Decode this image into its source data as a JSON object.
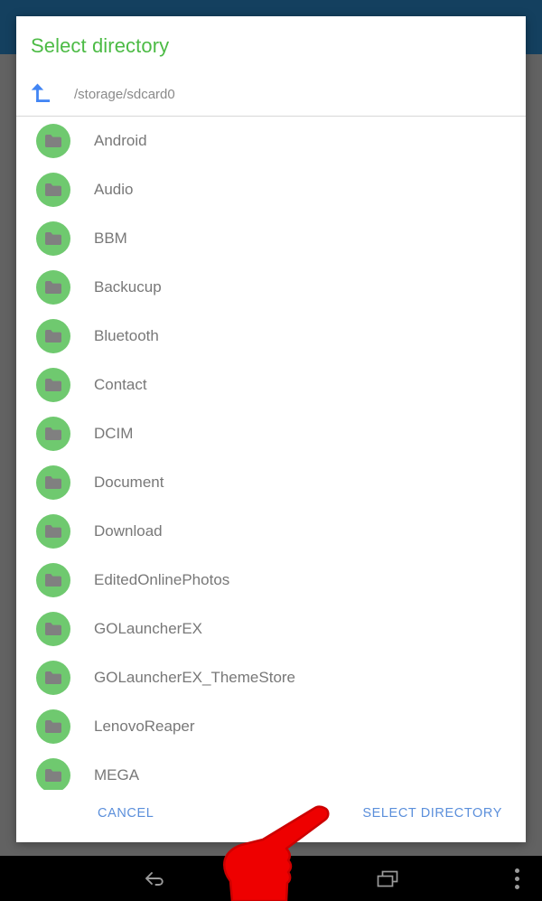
{
  "dialog": {
    "title": "Select directory",
    "path": {
      "icon": "arrow-up-icon",
      "value": "/storage/sdcard0"
    },
    "items": [
      {
        "icon": "folder-icon",
        "label": "Android"
      },
      {
        "icon": "folder-icon",
        "label": "Audio"
      },
      {
        "icon": "folder-icon",
        "label": "BBM"
      },
      {
        "icon": "folder-icon",
        "label": "Backucup"
      },
      {
        "icon": "folder-icon",
        "label": "Bluetooth"
      },
      {
        "icon": "folder-icon",
        "label": "Contact"
      },
      {
        "icon": "folder-icon",
        "label": "DCIM"
      },
      {
        "icon": "folder-icon",
        "label": "Document"
      },
      {
        "icon": "folder-icon",
        "label": "Download"
      },
      {
        "icon": "folder-icon",
        "label": "EditedOnlinePhotos"
      },
      {
        "icon": "folder-icon",
        "label": "GOLauncherEX"
      },
      {
        "icon": "folder-icon",
        "label": "GOLauncherEX_ThemeStore"
      },
      {
        "icon": "folder-icon",
        "label": "LenovoReaper"
      },
      {
        "icon": "folder-icon",
        "label": "MEGA"
      }
    ],
    "actions": {
      "cancel": "CANCEL",
      "confirm": "SELECT DIRECTORY"
    }
  },
  "navigation_bar": {
    "back": "back-icon",
    "home": "home-icon",
    "recents": "recents-icon",
    "more": "overflow-menu-icon"
  },
  "cursor": {
    "type": "pointing-hand-cursor"
  },
  "colors": {
    "status_bar": "#14405f",
    "scrim": "#626262",
    "dialog_background": "#ffffff",
    "title_green": "#4cbb45",
    "folder_circle_green": "#6fc96f",
    "folder_glyph_gray": "#808080",
    "item_label_gray": "#787878",
    "path_gray": "#8a8a8a",
    "action_blue": "#5b8fdb",
    "arrow_blue": "#4285f4",
    "nav_bar": "#000000",
    "nav_icon_gray": "#9b9b9b",
    "cursor_red": "#ee0000"
  }
}
